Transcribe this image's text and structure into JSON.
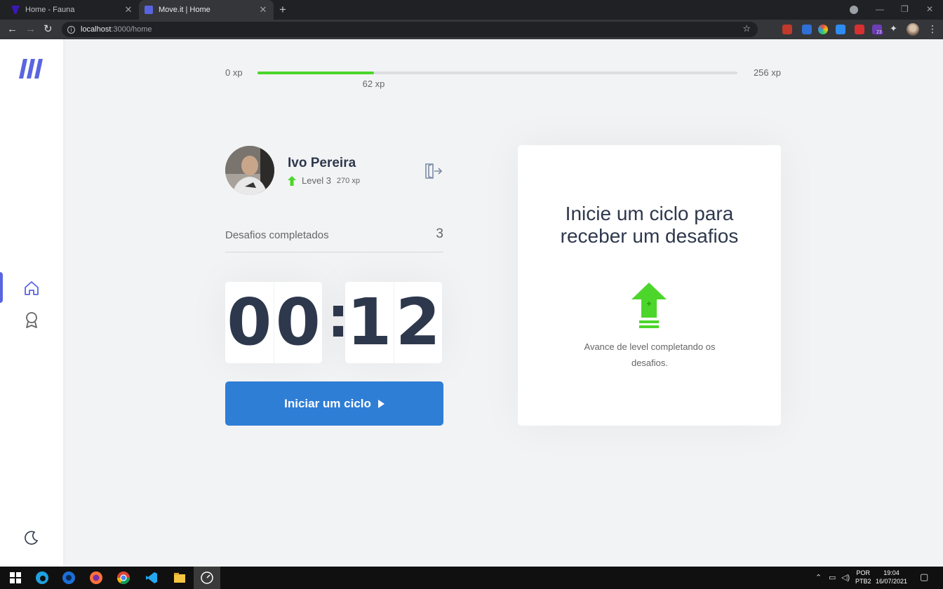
{
  "browser": {
    "tabs": [
      {
        "label": "Home - Fauna",
        "active": false
      },
      {
        "label": "Move.it | Home",
        "active": true
      }
    ],
    "url_host": "localhost",
    "url_path": ":3000/home",
    "extension_badge": "23"
  },
  "xp": {
    "min_label": "0 xp",
    "max_label": "256 xp",
    "current_label": "62 xp",
    "progress_fraction": 0.242,
    "accent_color": "#4cd62b"
  },
  "profile": {
    "name": "Ivo Pereira",
    "level_label": "Level 3",
    "xp_label": "270 xp"
  },
  "challenges": {
    "label": "Desafios completados",
    "value": "3"
  },
  "countdown": {
    "minute_left": "0",
    "minute_right": "0",
    "colon": ":",
    "second_left": "1",
    "second_right": "2"
  },
  "start_button": {
    "label": "Iniciar um ciclo",
    "color": "#2e7ed6"
  },
  "challenge_box": {
    "title": "Inicie um ciclo para receber um desafios",
    "description": "Avance de level completando os desafios."
  },
  "sidebar": {
    "items": [
      {
        "name": "home",
        "active": true
      },
      {
        "name": "leaderboard",
        "active": false
      }
    ],
    "brand_color": "#5965e0"
  },
  "taskbar": {
    "lang_top": "POR",
    "lang_bottom": "PTB2",
    "time": "19:04",
    "date": "16/07/2021"
  }
}
